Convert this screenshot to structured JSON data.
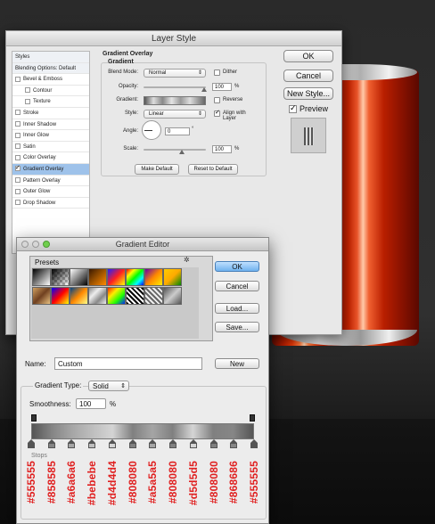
{
  "layer_style": {
    "title": "Layer Style",
    "styles_list": [
      {
        "label": "Styles",
        "checkbox": false,
        "checked": false,
        "indent": false,
        "selected": false,
        "header": true
      },
      {
        "label": "Blending Options: Default",
        "checkbox": false,
        "checked": false,
        "indent": false,
        "selected": false,
        "header": true
      },
      {
        "label": "Bevel & Emboss",
        "checkbox": true,
        "checked": false,
        "indent": false,
        "selected": false
      },
      {
        "label": "Contour",
        "checkbox": true,
        "checked": false,
        "indent": true,
        "selected": false
      },
      {
        "label": "Texture",
        "checkbox": true,
        "checked": false,
        "indent": true,
        "selected": false
      },
      {
        "label": "Stroke",
        "checkbox": true,
        "checked": false,
        "indent": false,
        "selected": false
      },
      {
        "label": "Inner Shadow",
        "checkbox": true,
        "checked": false,
        "indent": false,
        "selected": false
      },
      {
        "label": "Inner Glow",
        "checkbox": true,
        "checked": false,
        "indent": false,
        "selected": false
      },
      {
        "label": "Satin",
        "checkbox": true,
        "checked": false,
        "indent": false,
        "selected": false
      },
      {
        "label": "Color Overlay",
        "checkbox": true,
        "checked": false,
        "indent": false,
        "selected": false
      },
      {
        "label": "Gradient Overlay",
        "checkbox": true,
        "checked": true,
        "indent": false,
        "selected": true
      },
      {
        "label": "Pattern Overlay",
        "checkbox": true,
        "checked": false,
        "indent": false,
        "selected": false
      },
      {
        "label": "Outer Glow",
        "checkbox": true,
        "checked": false,
        "indent": false,
        "selected": false
      },
      {
        "label": "Drop Shadow",
        "checkbox": true,
        "checked": false,
        "indent": false,
        "selected": false
      }
    ],
    "panel_title": "Gradient Overlay",
    "panel_subtitle": "Gradient",
    "blend_mode_label": "Blend Mode:",
    "blend_mode_value": "Normal",
    "dither_label": "Dither",
    "opacity_label": "Opacity:",
    "opacity_value": "100",
    "percent": "%",
    "gradient_label": "Gradient:",
    "reverse_label": "Reverse",
    "style_label": "Style:",
    "style_value": "Linear",
    "align_label": "Align with Layer",
    "angle_label": "Angle:",
    "angle_value": "0",
    "degree": "°",
    "scale_label": "Scale:",
    "scale_value": "100",
    "make_default": "Make Default",
    "reset_default": "Reset to Default",
    "ok": "OK",
    "cancel": "Cancel",
    "new_style": "New Style...",
    "preview": "Preview"
  },
  "gradient_editor": {
    "title": "Gradient Editor",
    "presets_label": "Presets",
    "ok": "OK",
    "cancel": "Cancel",
    "load": "Load...",
    "save": "Save...",
    "name_label": "Name:",
    "name_value": "Custom",
    "new": "New",
    "gradient_type_label": "Gradient Type:",
    "gradient_type_value": "Solid",
    "smoothness_label": "Smoothness:",
    "smoothness_value": "100",
    "smoothness_unit": "%",
    "stops_label": "Stops",
    "color_stops": [
      "#555555",
      "#858585",
      "#a6a6a6",
      "#bebebe",
      "#d4d4d4",
      "#808080",
      "#a5a5a5",
      "#808080",
      "#d5d5d5",
      "#808080",
      "#868686",
      "#555555"
    ],
    "hex_labels": [
      "#555555",
      "#858585",
      "#a6a6a6",
      "#bebebe",
      "#d4d4d4",
      "#808080",
      "#a5a5a5",
      "#808080",
      "#d5d5d5",
      "#808080",
      "#868686",
      "#555555"
    ]
  },
  "colors": {
    "annotation": "#e02020",
    "selection": "#9ec2ea",
    "can_red": "#c72400"
  }
}
